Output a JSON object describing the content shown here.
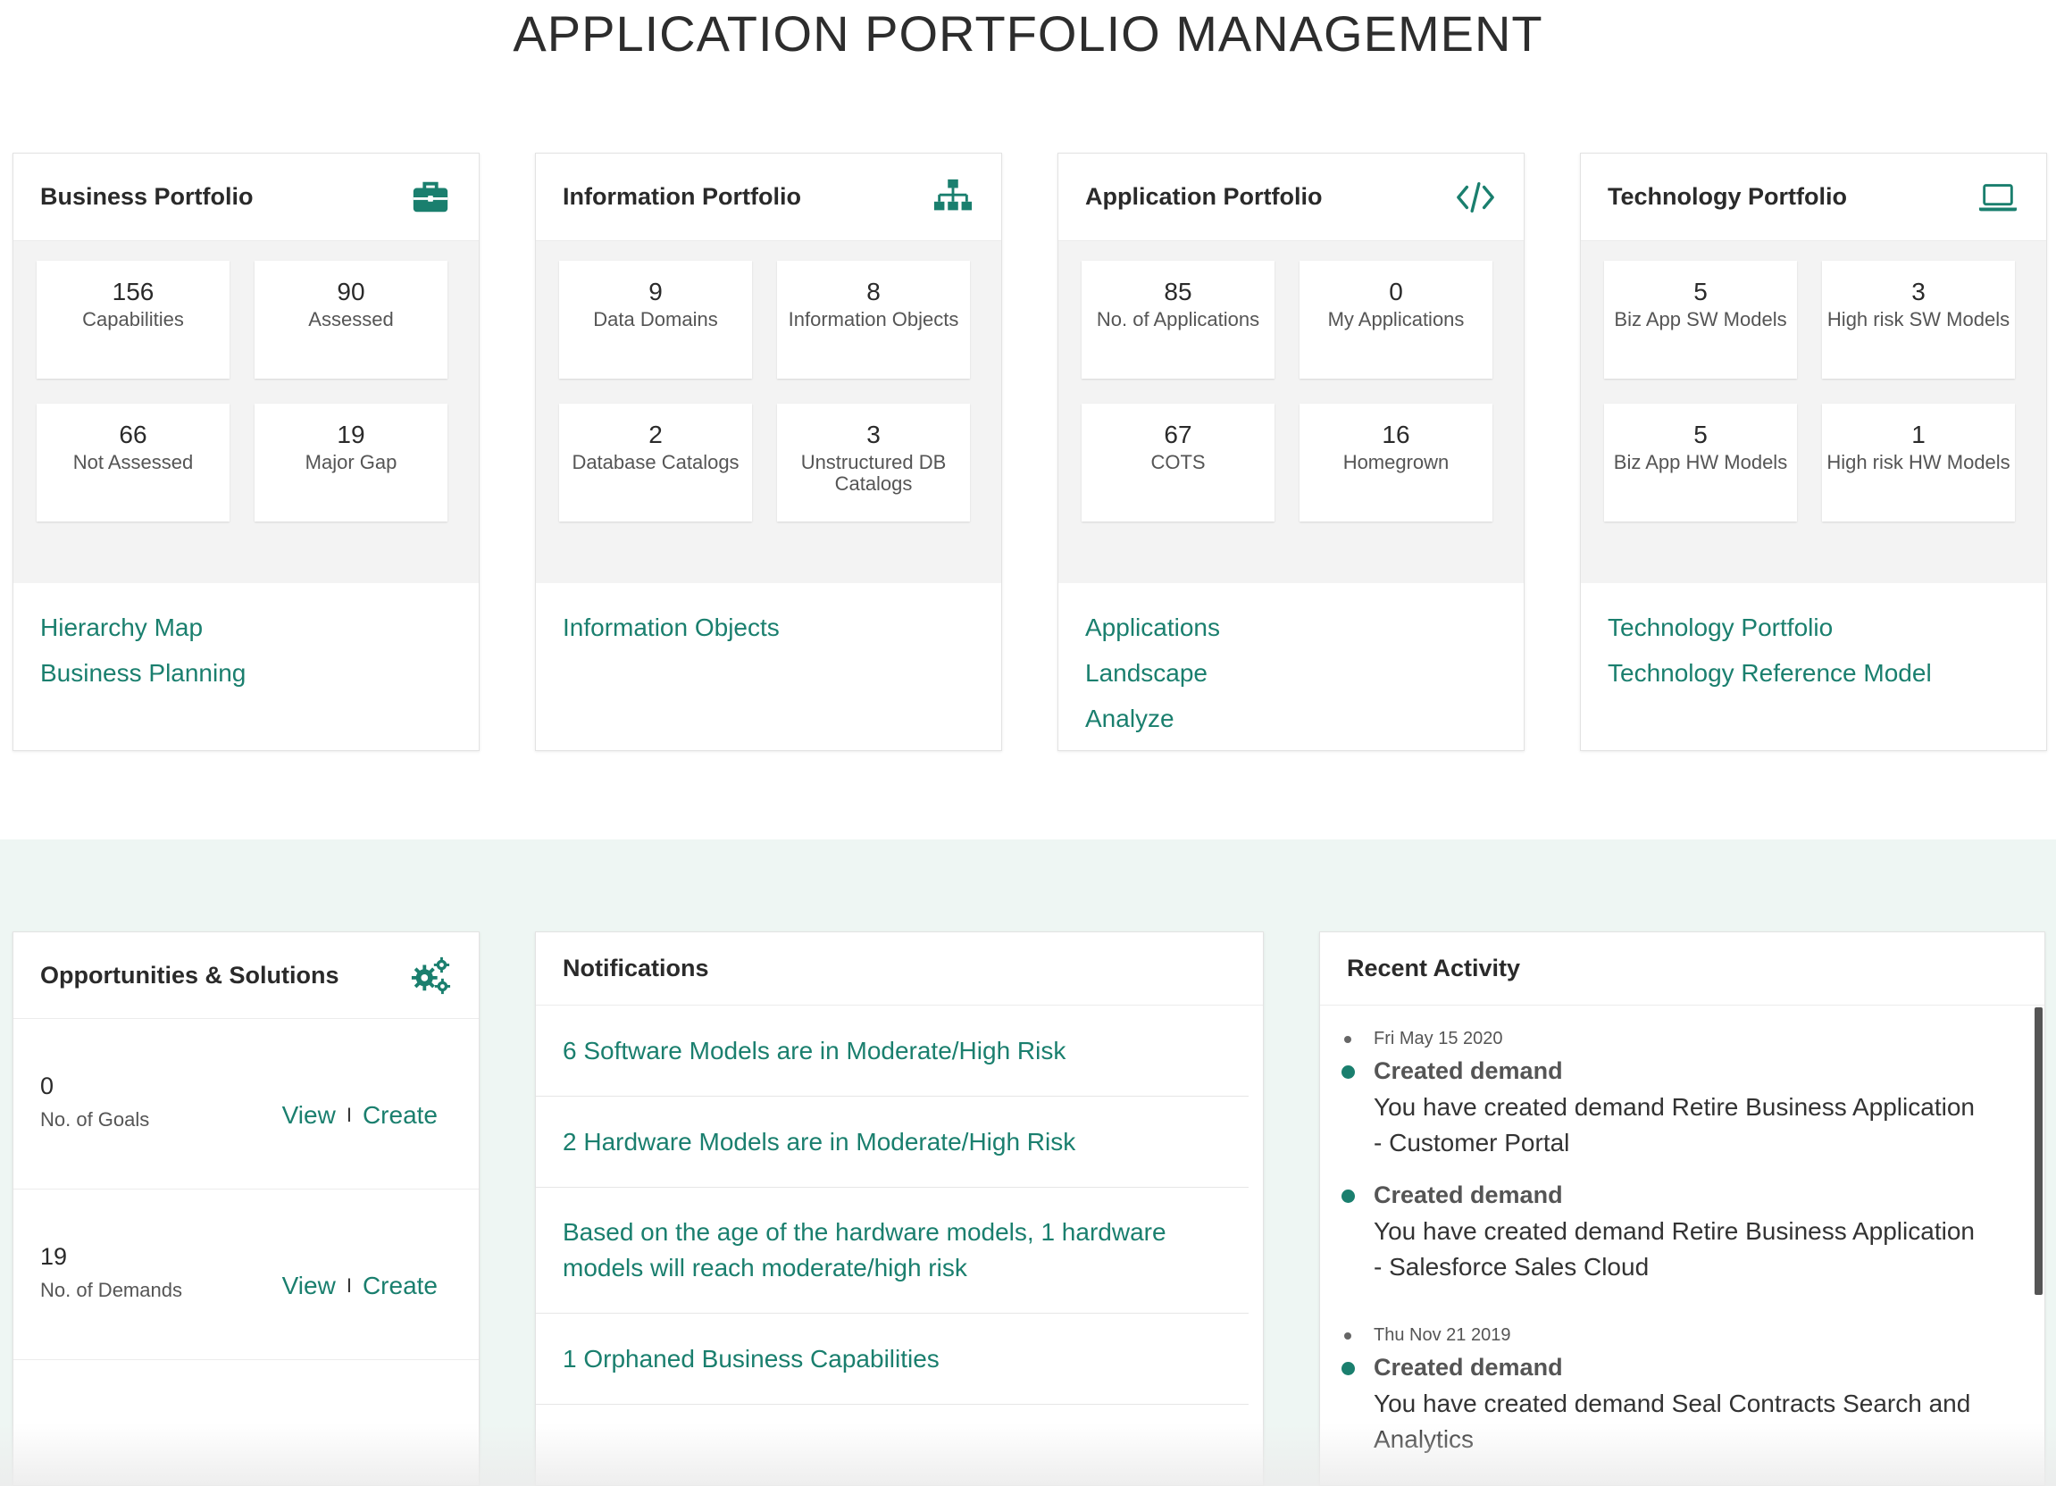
{
  "page_title": "APPLICATION PORTFOLIO MANAGEMENT",
  "colors": {
    "accent": "#1a7f6e",
    "band_bg": "#eef6f3",
    "stats_bg": "#f3f3f3"
  },
  "portfolios": [
    {
      "title": "Business Portfolio",
      "icon": "briefcase-icon",
      "stats": [
        {
          "value": "156",
          "label": "Capabilities"
        },
        {
          "value": "90",
          "label": "Assessed"
        },
        {
          "value": "66",
          "label": "Not Assessed"
        },
        {
          "value": "19",
          "label": "Major Gap"
        }
      ],
      "links": [
        "Hierarchy Map",
        "Business Planning"
      ]
    },
    {
      "title": "Information Portfolio",
      "icon": "sitemap-icon",
      "stats": [
        {
          "value": "9",
          "label": "Data Domains"
        },
        {
          "value": "8",
          "label": "Information Objects"
        },
        {
          "value": "2",
          "label": "Database Catalogs"
        },
        {
          "value": "3",
          "label": "Unstructured DB Catalogs"
        }
      ],
      "links": [
        "Information Objects"
      ]
    },
    {
      "title": "Application Portfolio",
      "icon": "code-icon",
      "stats": [
        {
          "value": "85",
          "label": "No. of Applications"
        },
        {
          "value": "0",
          "label": "My Applications"
        },
        {
          "value": "67",
          "label": "COTS"
        },
        {
          "value": "16",
          "label": "Homegrown"
        }
      ],
      "links": [
        "Applications",
        "Landscape",
        "Analyze"
      ]
    },
    {
      "title": "Technology Portfolio",
      "icon": "laptop-icon",
      "stats": [
        {
          "value": "5",
          "label": "Biz App SW Models"
        },
        {
          "value": "3",
          "label": "High risk SW Models"
        },
        {
          "value": "5",
          "label": "Biz App HW Models"
        },
        {
          "value": "1",
          "label": "High risk HW Models"
        }
      ],
      "links": [
        "Technology Portfolio",
        "Technology Reference Model"
      ]
    }
  ],
  "opportunities": {
    "title": "Opportunities & Solutions",
    "icon": "gears-icon",
    "rows": [
      {
        "value": "0",
        "label": "No. of Goals",
        "view": "View",
        "sep": "I",
        "create": "Create"
      },
      {
        "value": "19",
        "label": "No. of Demands",
        "view": "View",
        "sep": "I",
        "create": "Create"
      }
    ]
  },
  "notifications": {
    "title": "Notifications",
    "items": [
      "6 Software Models are in Moderate/High Risk",
      "2 Hardware Models are in Moderate/High Risk",
      "Based on the age of the hardware models, 1 hardware models will reach moderate/high risk",
      "1 Orphaned Business Capabilities"
    ]
  },
  "activity": {
    "title": "Recent Activity",
    "date1": "Fri May 15 2020",
    "entries": [
      {
        "title": "Created demand",
        "text": "You have created demand Retire Business Application - Customer Portal"
      },
      {
        "title": "Created demand",
        "text": "You have created demand Retire Business Application - Salesforce Sales Cloud"
      }
    ],
    "date2": "Thu Nov 21 2019",
    "entry3": {
      "title": "Created demand",
      "text": "You have created demand Seal Contracts Search and Analytics"
    }
  }
}
